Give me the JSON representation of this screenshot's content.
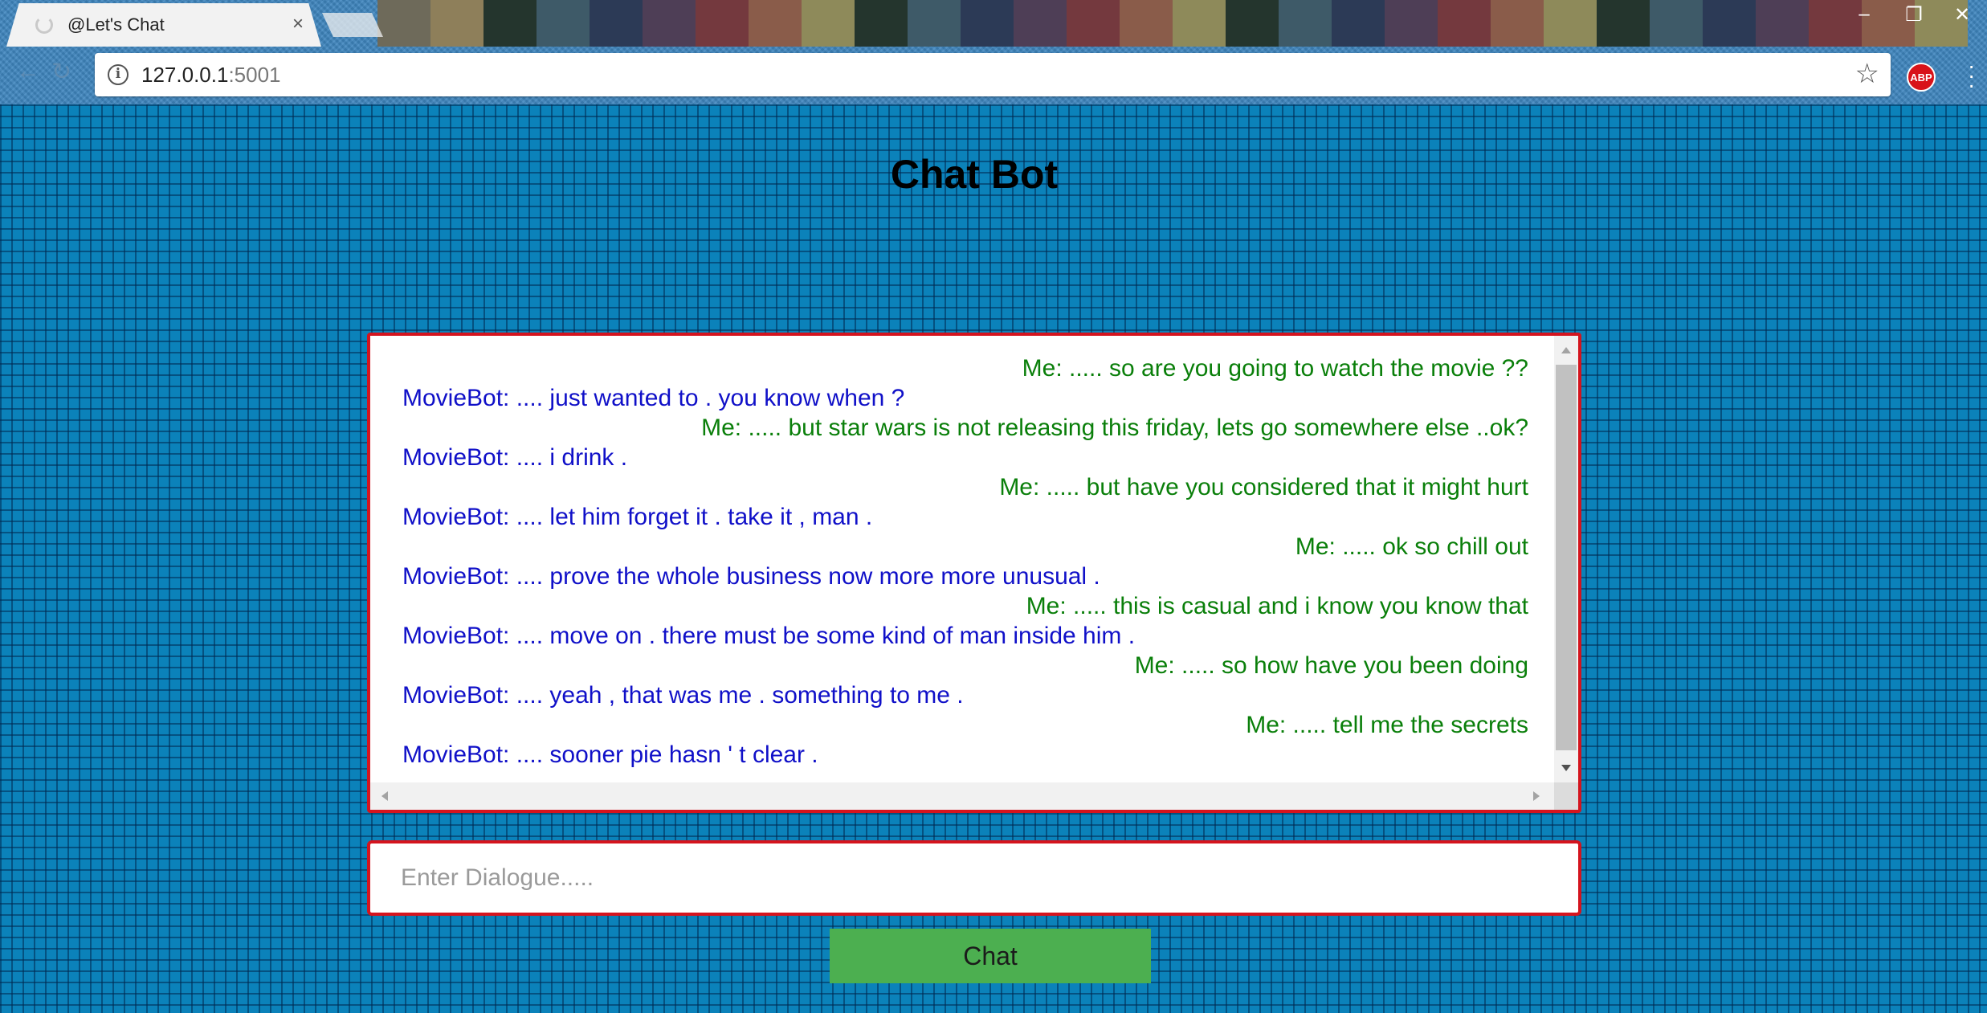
{
  "browser": {
    "tab_title": "@Let's Chat",
    "tab_close": "×",
    "url_host": "127.0.0.1",
    "url_port": ":5001",
    "abp_label": "ABP",
    "window_controls": {
      "minimize": "–",
      "restore": "❐",
      "close": "✕"
    },
    "theme_swatches": [
      "#6e6a5a",
      "#8e7f5a",
      "#24352d",
      "#3e5a68",
      "#2c3a56",
      "#4e3e56",
      "#74393e",
      "#8a5c4a",
      "#8e8a5a",
      "#24352d",
      "#3e5a68",
      "#2c3a56",
      "#4e3e56",
      "#74393e",
      "#8a5c4a",
      "#8e8a5a",
      "#24352d",
      "#3e5a68",
      "#2c3a56",
      "#4e3e56",
      "#74393e",
      "#8a5c4a",
      "#8e8a5a",
      "#24352d",
      "#3e5a68",
      "#2c3a56",
      "#4e3e56",
      "#74393e",
      "#8a5c4a",
      "#8e8a5a"
    ]
  },
  "page": {
    "title": "Chat Bot",
    "messages": [
      {
        "sender": "me",
        "text": "Me: ..... so are you going to watch the movie ??"
      },
      {
        "sender": "bot",
        "text": "MovieBot: .... just wanted to . you know when ?"
      },
      {
        "sender": "me",
        "text": "Me: ..... but star wars is not releasing this friday, lets go somewhere else ..ok?"
      },
      {
        "sender": "bot",
        "text": "MovieBot: .... i drink ."
      },
      {
        "sender": "me",
        "text": "Me: ..... but have you considered that it might hurt"
      },
      {
        "sender": "bot",
        "text": "MovieBot: .... let him forget it . take it , man ."
      },
      {
        "sender": "me",
        "text": "Me: ..... ok so chill out"
      },
      {
        "sender": "bot",
        "text": "MovieBot: .... prove the whole business now more more unusual ."
      },
      {
        "sender": "me",
        "text": "Me: ..... this is casual and i know you know that"
      },
      {
        "sender": "bot",
        "text": "MovieBot: .... move on . there must be some kind of man inside him ."
      },
      {
        "sender": "me",
        "text": "Me: ..... so how have you been doing"
      },
      {
        "sender": "bot",
        "text": "MovieBot: .... yeah , that was me . something to me ."
      },
      {
        "sender": "me",
        "text": "Me: ..... tell me the secrets"
      },
      {
        "sender": "bot",
        "text": "MovieBot: .... sooner pie hasn ' t clear ."
      }
    ],
    "input": {
      "placeholder": "Enter Dialogue.....",
      "value": ""
    },
    "chat_button": "Chat"
  },
  "colors": {
    "me_text": "#0a7f0a",
    "bot_text": "#1010c8",
    "box_border": "#d4141e",
    "button_bg": "#4caf50",
    "page_bg": "#0b82ba"
  }
}
